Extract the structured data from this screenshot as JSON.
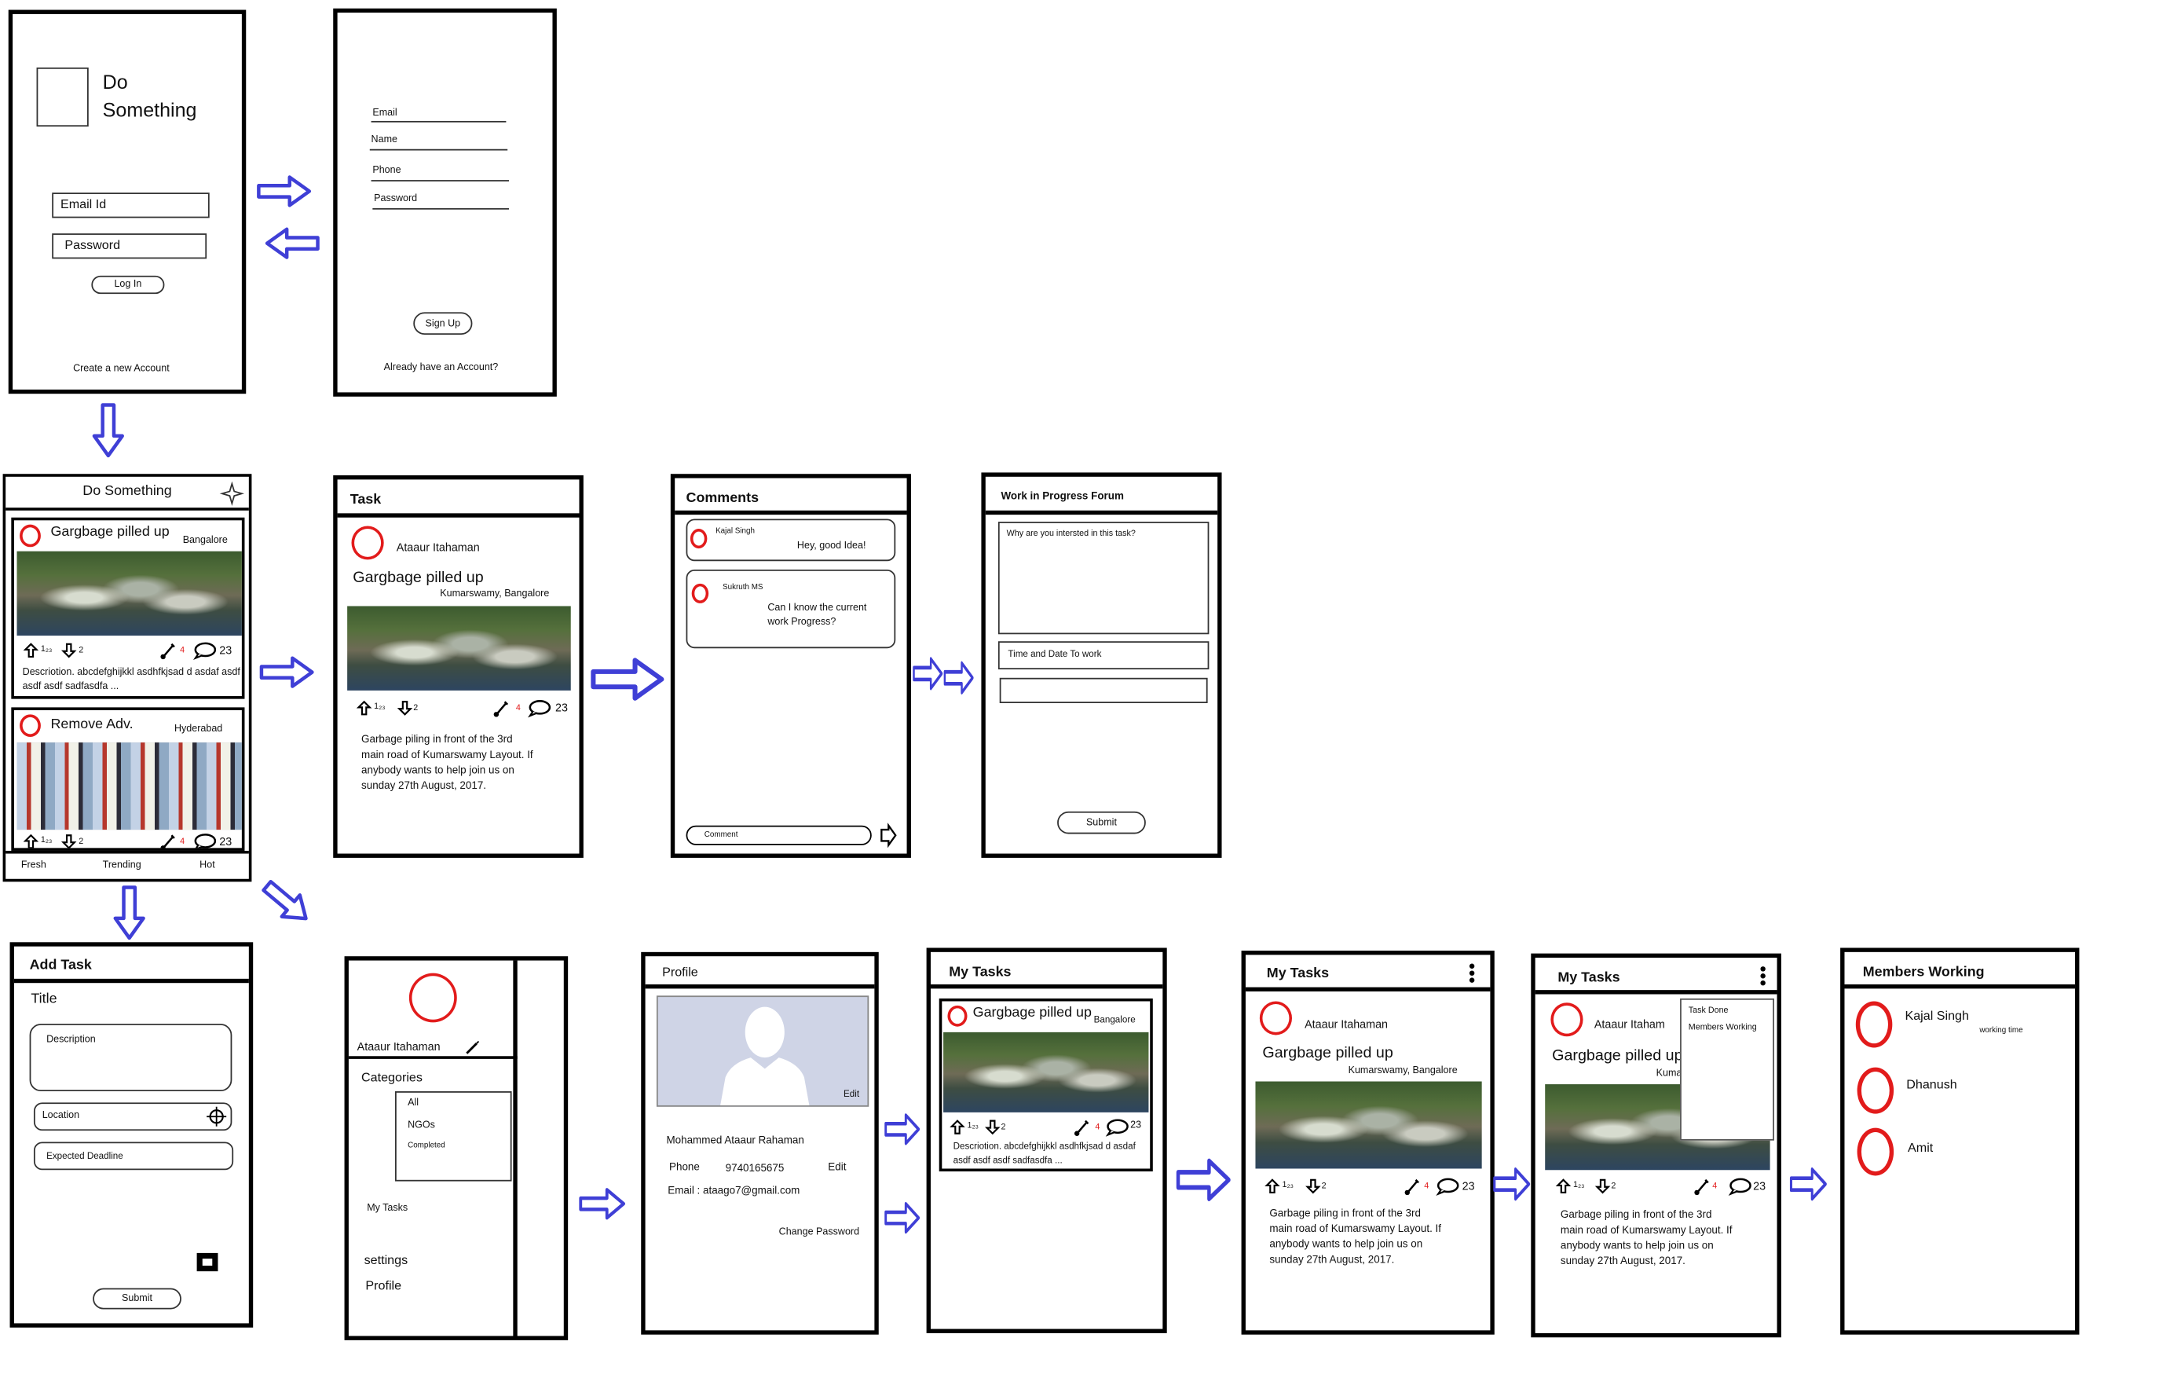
{
  "colors": {
    "arrow": "#3f3fd6",
    "accent_red": "#e21b1b",
    "border": "#000000"
  },
  "login": {
    "app_name": "Do\nSomething",
    "email_label": "Email Id",
    "password_label": "Password",
    "login_button": "Log In",
    "create_account": "Create a new Account"
  },
  "signup": {
    "fields": [
      "Email",
      "Name",
      "Phone",
      "Password"
    ],
    "signup_button": "Sign Up",
    "have_account": "Already have an Account?"
  },
  "feed": {
    "title": "Do Something",
    "posts": [
      {
        "title": "Gargbage pilled up",
        "city": "Bangalore",
        "upvotes": "1₂₃",
        "downvotes": "2",
        "helpers": "4",
        "comments": "23",
        "description": "Descriotion. abcdefghijkkl asdhfkjsad d asdaf asdf asdf asdf sadfasdfa ..."
      },
      {
        "title": "Remove Adv.",
        "city": "Hyderabad",
        "upvotes": "1₂₃",
        "downvotes": "2",
        "helpers": "4",
        "comments": "23"
      }
    ],
    "tabs": [
      "Fresh",
      "Trending",
      "Hot"
    ]
  },
  "task": {
    "header": "Task",
    "author": "Ataaur Itahaman",
    "title": "Gargbage pilled up",
    "location": "Kumarswamy, Bangalore",
    "upvotes": "1₂₃",
    "downvotes": "2",
    "helpers": "4",
    "comments": "23",
    "description": "Garbage piling in front of the 3rd\nmain road of Kumarswamy Layout. If\nanybody wants to help join us on\nsunday 27th August, 2017."
  },
  "comments": {
    "header": "Comments",
    "items": [
      {
        "name": "Kajal Singh",
        "text": "Hey, good Idea!"
      },
      {
        "name": "Sukruth MS",
        "text": "Can I know the current\nwork Progress?"
      }
    ],
    "input_placeholder": "Comment"
  },
  "wip": {
    "header": "Work in Progress Forum",
    "question": "Why are you intersted in this task?",
    "time_label": "Time and Date  To work",
    "submit": "Submit"
  },
  "add_task": {
    "header": "Add Task",
    "title_label": "Title",
    "description": "Description",
    "location": "Location",
    "deadline": "Expected Deadline",
    "submit": "Submit"
  },
  "drawer": {
    "user": "Ataaur Itahaman",
    "categories_label": "Categories",
    "categories": [
      "All",
      "NGOs",
      "Completed"
    ],
    "my_tasks": "My Tasks",
    "settings": "settings",
    "profile": "Profile"
  },
  "profile": {
    "header": "Profile",
    "edit": "Edit",
    "name": "Mohammed Ataaur Rahaman",
    "phone_label": "Phone",
    "phone": "9740165675",
    "phone_edit": "Edit",
    "email": "Email : ataago7@gmail.com",
    "change_password": "Change Password"
  },
  "my_tasks_list": {
    "header": "My Tasks",
    "title": "Gargbage pilled up",
    "city": "Bangalore",
    "upvotes": "1₂₃",
    "downvotes": "2",
    "helpers": "4",
    "comments": "23",
    "description": "Descriotion. abcdefghijkkl asdhfkjsad d asdaf asdf asdf asdf sadfasdfa ..."
  },
  "my_tasks_detail": {
    "header": "My Tasks",
    "author": "Ataaur Itahaman",
    "title": "Gargbage pilled up",
    "location": "Kumarswamy, Bangalore",
    "upvotes": "1₂₃",
    "downvotes": "2",
    "helpers": "4",
    "comments": "23",
    "description": "Garbage piling in front of the 3rd\nmain road of Kumarswamy Layout. If\nanybody wants to help join us on\nsunday 27th August, 2017."
  },
  "my_tasks_menu": {
    "header": "My Tasks",
    "author": "Ataaur Itaham",
    "title": "Gargbage pilled up",
    "location": "Kumarsv",
    "menu": [
      "Task Done",
      "Members Working"
    ],
    "upvotes": "1₂₃",
    "downvotes": "2",
    "helpers": "4",
    "comments": "23",
    "description": "Garbage piling in front of the 3rd\nmain road of Kumarswamy Layout. If\nanybody wants to help join us on\nsunday 27th August, 2017."
  },
  "members": {
    "header": "Members Working",
    "items": [
      {
        "name": "Kajal Singh",
        "note": "working time"
      },
      {
        "name": "Dhanush"
      },
      {
        "name": "Amit"
      }
    ]
  }
}
